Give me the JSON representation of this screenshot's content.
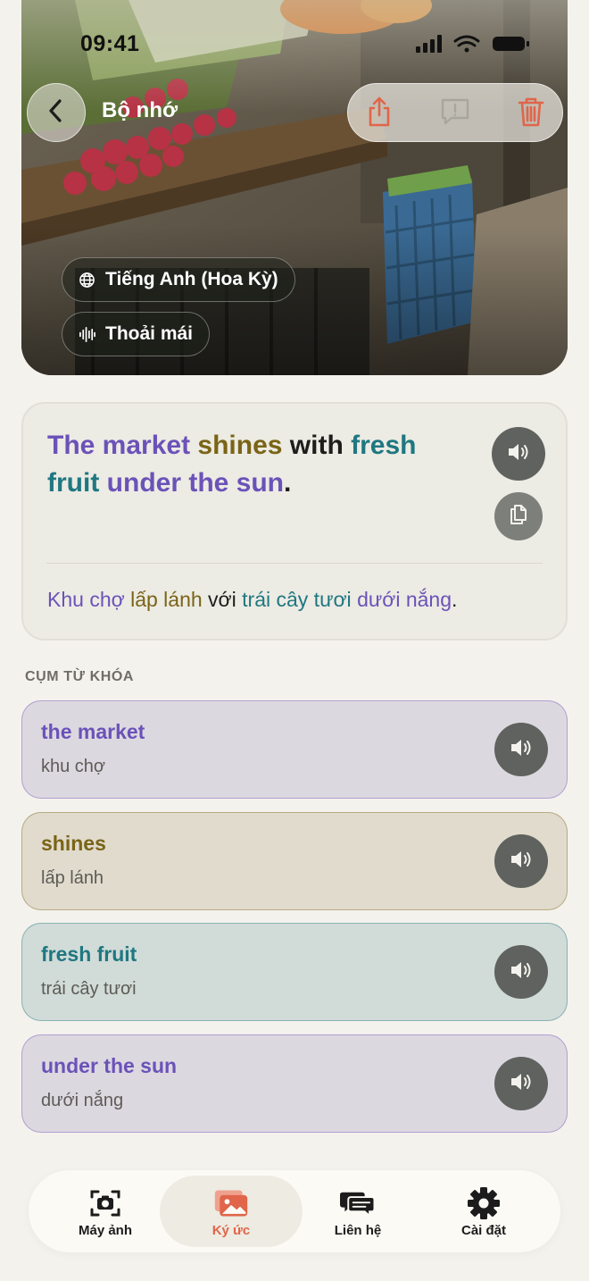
{
  "status_bar": {
    "time": "09:41"
  },
  "header": {
    "title": "Bộ nhớ",
    "language_chip": "Tiếng Anh (Hoa Kỳ)",
    "tone_chip": "Thoải mái"
  },
  "sentence": {
    "english": [
      {
        "text": "The market",
        "color": "purple"
      },
      {
        "text": " "
      },
      {
        "text": "shines",
        "color": "olive"
      },
      {
        "text": " with ",
        "color": "dark"
      },
      {
        "text": "fresh fruit",
        "color": "teal"
      },
      {
        "text": " "
      },
      {
        "text": "under the sun",
        "color": "purple"
      },
      {
        "text": ".",
        "color": "dark"
      }
    ],
    "vietnamese": [
      {
        "text": "Khu chợ",
        "color": "purple"
      },
      {
        "text": " "
      },
      {
        "text": "lấp lánh",
        "color": "olive"
      },
      {
        "text": " với ",
        "color": "dark"
      },
      {
        "text": "trái cây tươi",
        "color": "teal"
      },
      {
        "text": " "
      },
      {
        "text": "dưới nắng",
        "color": "purple"
      },
      {
        "text": ".",
        "color": "dark"
      }
    ]
  },
  "phrases_section": {
    "label": "CỤM TỪ KHÓA",
    "items": [
      {
        "english": "the market",
        "vietnamese": "khu chợ",
        "color": "purple"
      },
      {
        "english": "shines",
        "vietnamese": "lấp lánh",
        "color": "olive"
      },
      {
        "english": "fresh fruit",
        "vietnamese": "trái cây tươi",
        "color": "teal"
      },
      {
        "english": "under the sun",
        "vietnamese": "dưới nắng",
        "color": "purple"
      }
    ]
  },
  "tab_bar": {
    "tabs": [
      {
        "label": "Máy ảnh",
        "icon": "camera-icon"
      },
      {
        "label": "Ký ức",
        "icon": "photos-icon",
        "active": true
      },
      {
        "label": "Liên hệ",
        "icon": "chat-bubbles-icon"
      },
      {
        "label": "Cài đặt",
        "icon": "gear-icon"
      }
    ]
  },
  "colors": {
    "purple": "#6b52b8",
    "olive": "#7a6416",
    "teal": "#1f7781",
    "dark": "#1d1d1b",
    "accent": "#e0654a",
    "phrase_purple_bg": "#dcd8e0",
    "phrase_olive_bg": "#e0dbcd",
    "phrase_teal_bg": "#d1dbd8"
  }
}
